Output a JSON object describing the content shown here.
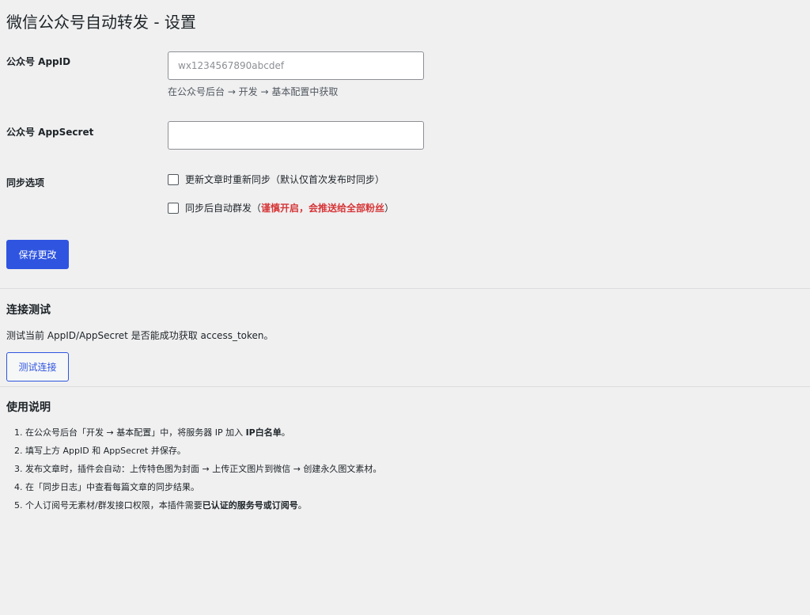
{
  "page": {
    "title": "微信公众号自动转发 - 设置"
  },
  "settings": {
    "appid_label": "公众号 AppID",
    "appid_placeholder": "wx1234567890abcdef",
    "appid_value": "",
    "appid_hint": "在公众号后台 → 开发 → 基本配置中获取",
    "appsecret_label": "公众号 AppSecret",
    "appsecret_value": "",
    "sync_label": "同步选项",
    "option_resync": {
      "label": "更新文章时重新同步（默认仅首次发布时同步）",
      "checked": false
    },
    "option_mass_send": {
      "label_prefix": "同步后自动群发（",
      "label_warning": "谨慎开启，会推送给全部粉丝",
      "label_suffix": "）",
      "checked": false,
      "warning_color": "#d63638"
    },
    "save_button": "保存更改"
  },
  "connection_test": {
    "title": "连接测试",
    "description": "测试当前 AppID/AppSecret 是否能成功获取 access_token。",
    "test_button": "测试连接"
  },
  "instructions": {
    "title": "使用说明",
    "items": [
      {
        "num": "1.",
        "before": "在公众号后台「开发 → 基本配置」中，将服务器 IP 加入 ",
        "bold": "IP白名单",
        "after": "。"
      },
      {
        "num": "2.",
        "before": "填写上方 AppID 和 AppSecret 并保存。",
        "bold": "",
        "after": ""
      },
      {
        "num": "3.",
        "before": "发布文章时，插件会自动：上传特色图为封面 → 上传正文图片到微信 → 创建永久图文素材。",
        "bold": "",
        "after": ""
      },
      {
        "num": "4.",
        "before": "在「同步日志」中查看每篇文章的同步结果。",
        "bold": "",
        "after": ""
      },
      {
        "num": "5.",
        "before": "个人订阅号无素材/群发接口权限，本插件需要",
        "bold": "已认证的服务号或订阅号",
        "after": "。"
      }
    ]
  },
  "colors": {
    "background": "#f0f0f1",
    "primary": "#2f55e0",
    "text": "#1d2327",
    "warning": "#d63638"
  }
}
